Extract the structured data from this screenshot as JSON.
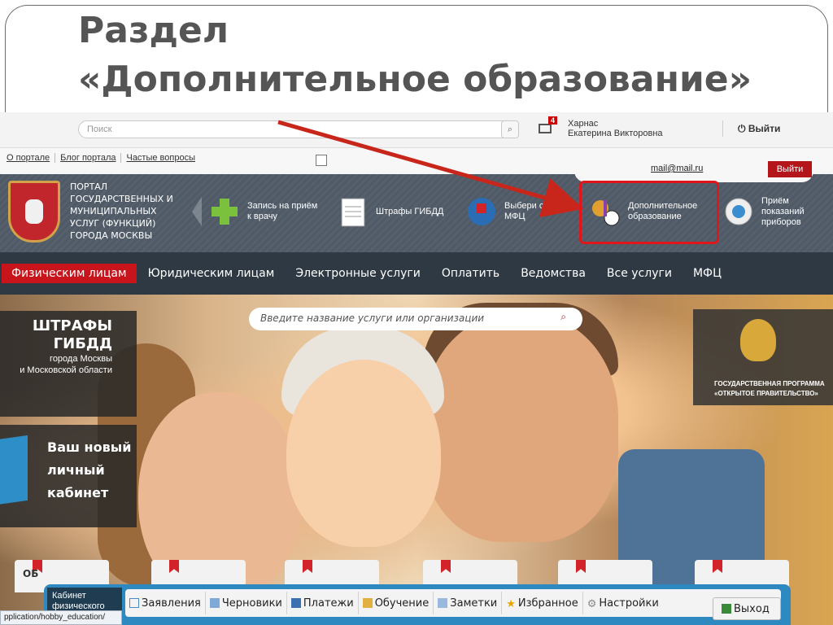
{
  "slide": {
    "title_line1": "Раздел",
    "title_line2": "«Дополнительное образование»"
  },
  "topbar": {
    "search_placeholder": "Поиск",
    "mail_count": "4",
    "user_line1": "Харнас",
    "user_line2": "Екатерина Викторовна",
    "logout": "Выйти"
  },
  "links": [
    "О портале",
    "Блог портала",
    "Частые вопросы"
  ],
  "account": {
    "email": "mail@mail.ru",
    "logout": "Выйти"
  },
  "portal": {
    "name_lines": [
      "Портал",
      "государственных и",
      "муниципальных",
      "услуг (функций)",
      "города Москвы"
    ],
    "services": [
      {
        "label": "Запись на приём к врачу",
        "icon": "medical-cross-icon"
      },
      {
        "label": "Штрафы ГИБДД",
        "icon": "fine-document-icon"
      },
      {
        "label": "Выбери свой МФЦ",
        "icon": "mfc-icon"
      },
      {
        "label": "Дополнительное образование",
        "icon": "education-hobby-icon"
      },
      {
        "label": "Приём показаний приборов",
        "icon": "meter-icon"
      }
    ]
  },
  "nav": [
    "Физическим лицам",
    "Юридическим лицам",
    "Электронные услуги",
    "Оплатить",
    "Ведомства",
    "Все услуги",
    "МФЦ"
  ],
  "hero": {
    "search_placeholder": "Введите название услуги или организации",
    "panel1_big1": "ШТРАФЫ",
    "panel1_big2": "ГИБДД",
    "panel1_small1": "города Москвы",
    "panel1_small2": "и Московской области",
    "panel2_lines": [
      "Ваш новый",
      "личный",
      "кабинет"
    ],
    "panel3_line1": "Государственная программа",
    "panel3_line2": "«Открытое правительство»",
    "bookmark_text": "ОБ"
  },
  "taskbar": {
    "cabinet_line1": "Кабинет",
    "cabinet_line2": "физического",
    "items": [
      "Заявления",
      "Черновики",
      "Платежи",
      "Обучение",
      "Заметки",
      "Избранное",
      "Настройки"
    ],
    "exit": "Выход"
  },
  "status_url": "pplication/hobby_education/",
  "colors": {
    "accent_red": "#c8141b",
    "nav_bg": "#2f3943",
    "highlight": "#e0161b",
    "taskbar_blue": "#2d89bf"
  }
}
